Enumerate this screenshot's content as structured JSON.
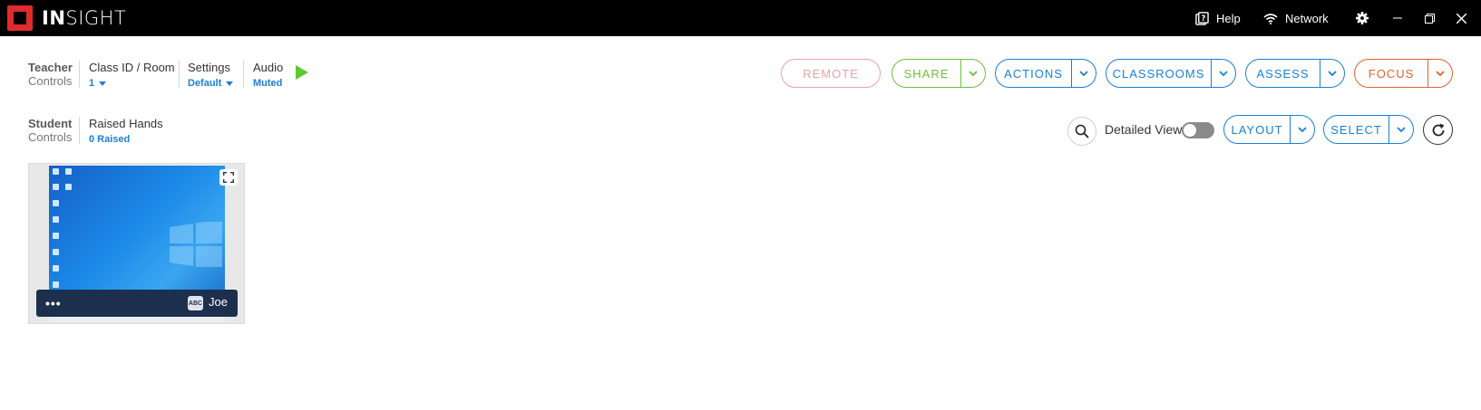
{
  "app": {
    "logo_bold": "IN",
    "logo_light": "SIGHT"
  },
  "titlebar": {
    "help_label": "Help",
    "network_label": "Network"
  },
  "teacher_controls": {
    "label_line1": "Teacher",
    "label_line2": "Controls",
    "class_title": "Class ID / Room",
    "class_value": "1",
    "settings_title": "Settings",
    "settings_value": "Default",
    "audio_title": "Audio",
    "audio_value": "Muted"
  },
  "actions": {
    "remote": "REMOTE",
    "share": "SHARE",
    "actions": "ACTIONS",
    "classrooms": "CLASSROOMS",
    "assess": "ASSESS",
    "focus": "FOCUS"
  },
  "student_controls": {
    "label_line1": "Student",
    "label_line2": "Controls",
    "raised_title": "Raised Hands",
    "raised_value": "0 Raised",
    "detailed_view_label": "Detailed View",
    "detailed_view_on": false,
    "layout": "LAYOUT",
    "select": "SELECT"
  },
  "students": [
    {
      "name": "Joe",
      "badge": "ABC",
      "more": "•••"
    }
  ],
  "colors": {
    "remote": "#e8a3a8",
    "share": "#6cbf3c",
    "blue": "#1a7fd4",
    "focus": "#e3622a",
    "play": "#5cc932",
    "titlebar": "#000000",
    "logo_red": "#e02b2b"
  }
}
